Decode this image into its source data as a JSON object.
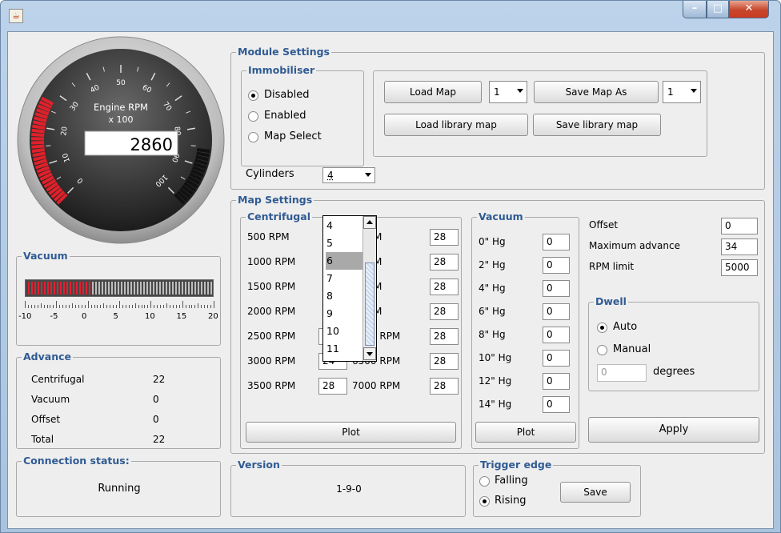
{
  "window": {
    "icon": "java-cup-icon",
    "min_label": "–",
    "max_label": "□",
    "close_label": "✕"
  },
  "gauge": {
    "title": "Engine RPM",
    "multiplier": "x 100",
    "value": "2860",
    "scale": [
      "0",
      "10",
      "20",
      "30",
      "40",
      "50",
      "60",
      "70",
      "80",
      "90",
      "100"
    ]
  },
  "vacuum_bar": {
    "title": "Vacuum",
    "ticks": [
      "-10",
      "-5",
      "0",
      "5",
      "10",
      "15",
      "20"
    ],
    "fill_fraction": 0.35
  },
  "advance": {
    "title": "Advance",
    "rows": [
      {
        "label": "Centrifugal",
        "value": "22"
      },
      {
        "label": "Vacuum",
        "value": "0"
      },
      {
        "label": "Offset",
        "value": "0"
      },
      {
        "label": "Total",
        "value": "22"
      }
    ]
  },
  "connection": {
    "title": "Connection status:",
    "status": "Running"
  },
  "module": {
    "title": "Module Settings",
    "immobiliser": {
      "title": "Immobiliser",
      "options": [
        "Disabled",
        "Enabled",
        "Map Select"
      ],
      "selected": "Disabled"
    },
    "load_map": "Load Map",
    "load_slot": "1",
    "save_map_as": "Save Map As",
    "save_slot": "1",
    "load_library": "Load library map",
    "save_library": "Save library map",
    "cylinders_label": "Cylinders",
    "cylinders_value": "4",
    "cylinders_options": [
      "4",
      "5",
      "6",
      "7",
      "8",
      "9",
      "10",
      "11"
    ],
    "cylinders_highlight": "6"
  },
  "map": {
    "title": "Map Settings",
    "centrifugal": {
      "title": "Centrifugal",
      "left": [
        {
          "rpm": "500 RPM",
          "value": ""
        },
        {
          "rpm": "1000 RPM",
          "value": ""
        },
        {
          "rpm": "1500 RPM",
          "value": ""
        },
        {
          "rpm": "2000 RPM",
          "value": ""
        },
        {
          "rpm": "2500 RPM",
          "value": "20"
        },
        {
          "rpm": "3000 RPM",
          "value": "24"
        },
        {
          "rpm": "3500 RPM",
          "value": "28"
        }
      ],
      "right": [
        {
          "rpm": "0 RPM",
          "value": "28"
        },
        {
          "rpm": "0 RPM",
          "value": "28"
        },
        {
          "rpm": "0 RPM",
          "value": "28"
        },
        {
          "rpm": "0 RPM",
          "value": "28"
        },
        {
          "rpm": "6000 RPM",
          "value": "28"
        },
        {
          "rpm": "6500 RPM",
          "value": "28"
        },
        {
          "rpm": "7000 RPM",
          "value": "28"
        }
      ],
      "plot": "Plot"
    },
    "vacuum": {
      "title": "Vacuum",
      "rows": [
        {
          "label": "0\" Hg",
          "value": "0"
        },
        {
          "label": "2\" Hg",
          "value": "0"
        },
        {
          "label": "4\" Hg",
          "value": "0"
        },
        {
          "label": "6\" Hg",
          "value": "0"
        },
        {
          "label": "8\" Hg",
          "value": "0"
        },
        {
          "label": "10\" Hg",
          "value": "0"
        },
        {
          "label": "12\" Hg",
          "value": "0"
        },
        {
          "label": "14\" Hg",
          "value": "0"
        }
      ],
      "plot": "Plot"
    },
    "offset_label": "Offset",
    "offset_value": "0",
    "max_adv_label": "Maximum advance",
    "max_adv_value": "34",
    "rpm_limit_label": "RPM limit",
    "rpm_limit_value": "5000",
    "dwell": {
      "title": "Dwell",
      "options": [
        "Auto",
        "Manual"
      ],
      "selected": "Auto",
      "degrees_value": "0",
      "degrees_label": "degrees"
    },
    "apply": "Apply"
  },
  "version": {
    "title": "Version",
    "value": "1-9-0"
  },
  "trigger": {
    "title": "Trigger edge",
    "options": [
      "Falling",
      "Rising"
    ],
    "selected": "Rising",
    "save": "Save"
  },
  "colors": {
    "accent_label": "#305b93",
    "gauge_red": "#e0202a",
    "bar_red": "#d0202a"
  }
}
